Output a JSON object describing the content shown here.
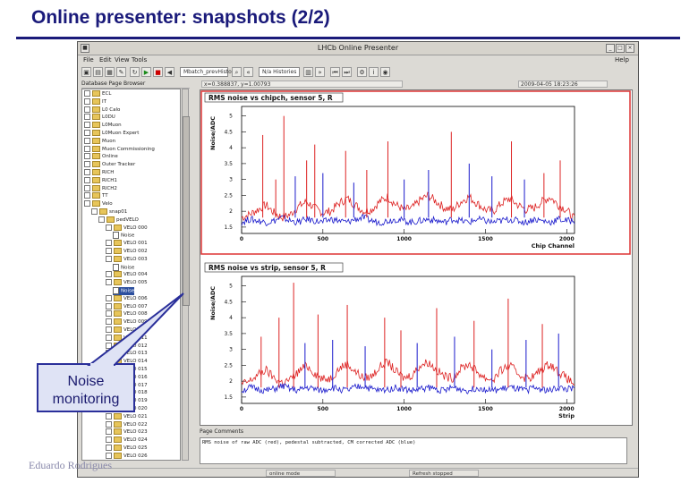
{
  "slide": {
    "title": "Online presenter: snapshots (2/2)",
    "author": "Eduardo Rodrigues",
    "callout_line1": "Noise",
    "callout_line2": "monitoring"
  },
  "app": {
    "window_title": "LHCb Online Presenter",
    "menu": [
      "File",
      "Edit",
      "View",
      "Tools"
    ],
    "help_label": "Help",
    "mode_combo": "Mbatch_prevHistoric",
    "time_combo": "N/a Histories",
    "coords_text": "x=0.388837, y=1.00793",
    "timestamp": "2009-04-05 18:23:26",
    "tree_header": "Database Page Browser",
    "tree_items": [
      {
        "label": "ECL",
        "indent": 0,
        "type": "folder"
      },
      {
        "label": "IT",
        "indent": 0,
        "type": "folder"
      },
      {
        "label": "L0 Calo",
        "indent": 0,
        "type": "folder"
      },
      {
        "label": "L0DU",
        "indent": 0,
        "type": "folder"
      },
      {
        "label": "L0Muon",
        "indent": 0,
        "type": "folder"
      },
      {
        "label": "L0Muon Expert",
        "indent": 0,
        "type": "folder"
      },
      {
        "label": "Muon",
        "indent": 0,
        "type": "folder"
      },
      {
        "label": "Muon Commissioning",
        "indent": 0,
        "type": "folder"
      },
      {
        "label": "Online",
        "indent": 0,
        "type": "folder"
      },
      {
        "label": "Outer Tracker",
        "indent": 0,
        "type": "folder"
      },
      {
        "label": "RICH",
        "indent": 0,
        "type": "folder"
      },
      {
        "label": "RICH1",
        "indent": 0,
        "type": "folder"
      },
      {
        "label": "RICH2",
        "indent": 0,
        "type": "folder"
      },
      {
        "label": "TT",
        "indent": 0,
        "type": "folder"
      },
      {
        "label": "Velo",
        "indent": 0,
        "type": "folder"
      },
      {
        "label": "snap01",
        "indent": 1,
        "type": "folder"
      },
      {
        "label": "pedVELO",
        "indent": 2,
        "type": "folder"
      },
      {
        "label": "VELO 000",
        "indent": 3,
        "type": "folder"
      },
      {
        "label": "Noise",
        "indent": 4,
        "type": "page"
      },
      {
        "label": "VELO 001",
        "indent": 3,
        "type": "folder"
      },
      {
        "label": "VELO 002",
        "indent": 3,
        "type": "folder"
      },
      {
        "label": "VELO 003",
        "indent": 3,
        "type": "folder"
      },
      {
        "label": "Noise",
        "indent": 4,
        "type": "page"
      },
      {
        "label": "VELO 004",
        "indent": 3,
        "type": "folder"
      },
      {
        "label": "VELO 005",
        "indent": 3,
        "type": "folder"
      },
      {
        "label": "Noise",
        "indent": 4,
        "type": "page",
        "selected": true
      },
      {
        "label": "VELO 006",
        "indent": 3,
        "type": "folder"
      },
      {
        "label": "VELO 007",
        "indent": 3,
        "type": "folder"
      },
      {
        "label": "VELO 008",
        "indent": 3,
        "type": "folder"
      },
      {
        "label": "VELO 009",
        "indent": 3,
        "type": "folder"
      },
      {
        "label": "VELO 010",
        "indent": 3,
        "type": "folder"
      },
      {
        "label": "VELO 011",
        "indent": 3,
        "type": "folder"
      },
      {
        "label": "VELO 012",
        "indent": 3,
        "type": "folder"
      },
      {
        "label": "VELO 013",
        "indent": 3,
        "type": "folder"
      },
      {
        "label": "VELO 014",
        "indent": 3,
        "type": "folder"
      },
      {
        "label": "VELO 015",
        "indent": 3,
        "type": "folder"
      },
      {
        "label": "VELO 016",
        "indent": 3,
        "type": "folder"
      },
      {
        "label": "VELO 017",
        "indent": 3,
        "type": "folder"
      },
      {
        "label": "VELO 018",
        "indent": 3,
        "type": "folder"
      },
      {
        "label": "VELO 019",
        "indent": 3,
        "type": "folder"
      },
      {
        "label": "VELO 020",
        "indent": 3,
        "type": "folder"
      },
      {
        "label": "VELO 021",
        "indent": 3,
        "type": "folder"
      },
      {
        "label": "VELO 022",
        "indent": 3,
        "type": "folder"
      },
      {
        "label": "VELO 023",
        "indent": 3,
        "type": "folder"
      },
      {
        "label": "VELO 024",
        "indent": 3,
        "type": "folder"
      },
      {
        "label": "VELO 025",
        "indent": 3,
        "type": "folder"
      },
      {
        "label": "VELO 026",
        "indent": 3,
        "type": "folder"
      }
    ],
    "comments_header": "Page Comments",
    "comments_text": "RMS noise of raw ADC (red), pedestal subtracted, CM corrected ADC (blue)",
    "status_left": "online mode",
    "status_right": "Refresh stopped"
  },
  "chart_data": [
    {
      "type": "line",
      "title": "RMS noise vs chipch, sensor 5, R",
      "xlabel": "Chip Channel",
      "ylabel": "Noise/ADC",
      "xlim": [
        0,
        2048
      ],
      "ylim": [
        1.3,
        5.3
      ],
      "x_ticks": [
        0,
        500,
        1000,
        1500,
        2000
      ],
      "y_ticks": [
        1.5,
        2,
        2.5,
        3,
        3.5,
        4,
        4.5,
        5
      ],
      "series": [
        {
          "color": "#dd2222",
          "values": [
            1.8,
            1.9,
            2.05,
            2.2,
            1.95,
            1.8,
            1.9,
            2.15,
            2.3,
            2.1,
            1.95,
            2.0,
            2.25,
            2.4,
            2.2,
            2.0,
            2.05,
            2.3,
            2.45,
            2.2,
            2.05,
            2.1,
            2.35,
            2.5,
            2.3,
            2.1,
            2.05,
            2.3,
            2.45,
            2.25,
            2.05,
            2.0,
            2.25,
            2.4,
            2.2,
            2.05,
            2.1,
            2.3,
            2.45,
            2.2,
            2.05,
            1.75
          ]
        },
        {
          "color": "#1a1acc",
          "values": [
            1.65,
            1.75,
            1.7,
            1.65,
            1.7,
            1.8,
            1.7,
            1.65,
            1.75,
            1.7,
            1.65,
            1.75,
            1.7,
            1.65,
            1.75,
            1.8,
            1.7,
            1.65,
            1.7,
            1.75,
            1.7,
            1.65,
            1.7,
            1.75,
            1.7,
            1.65,
            1.75,
            1.7,
            1.65,
            1.75,
            1.7,
            1.65,
            1.7,
            1.75,
            1.7,
            1.65,
            1.75,
            1.7,
            1.65,
            1.75,
            1.7,
            1.7
          ]
        }
      ],
      "spikes": [
        {
          "x": 130,
          "y": 4.4,
          "color": "#dd2222"
        },
        {
          "x": 210,
          "y": 3.0,
          "color": "#dd2222"
        },
        {
          "x": 260,
          "y": 5.0,
          "color": "#dd2222"
        },
        {
          "x": 330,
          "y": 3.1,
          "color": "#1a1acc"
        },
        {
          "x": 400,
          "y": 3.6,
          "color": "#dd2222"
        },
        {
          "x": 450,
          "y": 4.1,
          "color": "#dd2222"
        },
        {
          "x": 500,
          "y": 3.2,
          "color": "#1a1acc"
        },
        {
          "x": 640,
          "y": 3.9,
          "color": "#dd2222"
        },
        {
          "x": 690,
          "y": 2.9,
          "color": "#1a1acc"
        },
        {
          "x": 770,
          "y": 3.3,
          "color": "#dd2222"
        },
        {
          "x": 900,
          "y": 4.2,
          "color": "#dd2222"
        },
        {
          "x": 1000,
          "y": 3.0,
          "color": "#1a1acc"
        },
        {
          "x": 1150,
          "y": 3.3,
          "color": "#1a1acc"
        },
        {
          "x": 1290,
          "y": 4.5,
          "color": "#dd2222"
        },
        {
          "x": 1400,
          "y": 3.5,
          "color": "#1a1acc"
        },
        {
          "x": 1540,
          "y": 3.1,
          "color": "#1a1acc"
        },
        {
          "x": 1660,
          "y": 4.2,
          "color": "#dd2222"
        },
        {
          "x": 1740,
          "y": 3.0,
          "color": "#1a1acc"
        },
        {
          "x": 1860,
          "y": 3.2,
          "color": "#dd2222"
        },
        {
          "x": 1960,
          "y": 3.6,
          "color": "#dd2222"
        }
      ]
    },
    {
      "type": "line",
      "title": "RMS noise vs strip, sensor 5, R",
      "xlabel": "Strip",
      "ylabel": "Noise/ADC",
      "xlim": [
        0,
        2048
      ],
      "ylim": [
        1.3,
        5.3
      ],
      "x_ticks": [
        0,
        500,
        1000,
        1500,
        2000
      ],
      "y_ticks": [
        1.5,
        2,
        2.5,
        3,
        3.5,
        4,
        4.5,
        5
      ],
      "series": [
        {
          "color": "#dd2222",
          "values": [
            1.9,
            2.0,
            2.2,
            2.35,
            2.1,
            1.95,
            2.05,
            2.3,
            2.5,
            2.25,
            2.05,
            2.1,
            2.4,
            2.55,
            2.3,
            2.1,
            2.15,
            2.45,
            2.6,
            2.3,
            2.1,
            2.2,
            2.5,
            2.6,
            2.35,
            2.15,
            2.1,
            2.4,
            2.55,
            2.3,
            2.1,
            2.05,
            2.35,
            2.5,
            2.25,
            2.1,
            2.15,
            2.4,
            2.55,
            2.3,
            2.1,
            1.9
          ]
        },
        {
          "color": "#1a1acc",
          "values": [
            1.7,
            1.8,
            1.75,
            1.7,
            1.75,
            1.85,
            1.75,
            1.7,
            1.8,
            1.75,
            1.7,
            1.8,
            1.75,
            1.7,
            1.8,
            1.85,
            1.75,
            1.7,
            1.75,
            1.8,
            1.75,
            1.7,
            1.75,
            1.8,
            1.75,
            1.7,
            1.8,
            1.75,
            1.7,
            1.8,
            1.75,
            1.7,
            1.75,
            1.8,
            1.75,
            1.7,
            1.8,
            1.75,
            1.7,
            1.8,
            1.75,
            1.75
          ]
        }
      ],
      "spikes": [
        {
          "x": 120,
          "y": 3.4,
          "color": "#dd2222"
        },
        {
          "x": 230,
          "y": 4.0,
          "color": "#dd2222"
        },
        {
          "x": 320,
          "y": 5.1,
          "color": "#dd2222"
        },
        {
          "x": 390,
          "y": 3.2,
          "color": "#1a1acc"
        },
        {
          "x": 470,
          "y": 4.1,
          "color": "#dd2222"
        },
        {
          "x": 560,
          "y": 3.3,
          "color": "#1a1acc"
        },
        {
          "x": 650,
          "y": 4.4,
          "color": "#dd2222"
        },
        {
          "x": 760,
          "y": 3.1,
          "color": "#1a1acc"
        },
        {
          "x": 880,
          "y": 4.0,
          "color": "#dd2222"
        },
        {
          "x": 980,
          "y": 3.6,
          "color": "#dd2222"
        },
        {
          "x": 1080,
          "y": 3.2,
          "color": "#1a1acc"
        },
        {
          "x": 1200,
          "y": 4.3,
          "color": "#dd2222"
        },
        {
          "x": 1310,
          "y": 3.4,
          "color": "#1a1acc"
        },
        {
          "x": 1430,
          "y": 3.9,
          "color": "#dd2222"
        },
        {
          "x": 1540,
          "y": 3.0,
          "color": "#1a1acc"
        },
        {
          "x": 1640,
          "y": 4.6,
          "color": "#dd2222"
        },
        {
          "x": 1750,
          "y": 3.3,
          "color": "#1a1acc"
        },
        {
          "x": 1850,
          "y": 3.8,
          "color": "#dd2222"
        },
        {
          "x": 1950,
          "y": 3.5,
          "color": "#1a1acc"
        }
      ]
    }
  ]
}
